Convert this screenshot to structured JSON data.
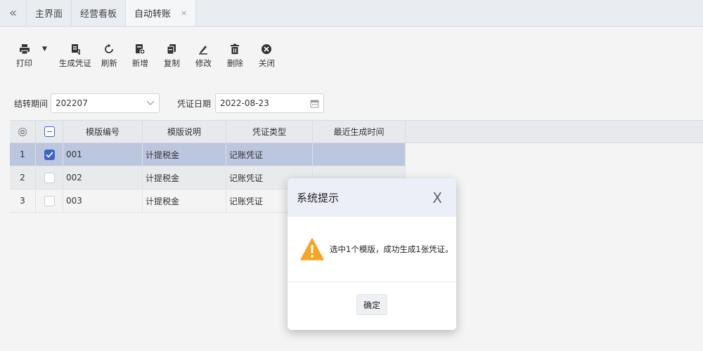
{
  "tabs": [
    {
      "label": "主界面"
    },
    {
      "label": "经营看板"
    },
    {
      "label": "自动转账",
      "active": true
    }
  ],
  "tab_collapse_icon": "double-chevron-left-icon",
  "tab_close_icon": "×",
  "toolbar": {
    "items": [
      {
        "label": "打印",
        "icon": "printer-icon"
      },
      {
        "label": "生成凭证",
        "icon": "generate-voucher-icon"
      },
      {
        "label": "刷新",
        "icon": "refresh-icon"
      },
      {
        "label": "新增",
        "icon": "add-doc-icon"
      },
      {
        "label": "复制",
        "icon": "copy-icon"
      },
      {
        "label": "修改",
        "icon": "edit-icon"
      },
      {
        "label": "删除",
        "icon": "trash-icon"
      },
      {
        "label": "关闭",
        "icon": "close-circle-icon"
      }
    ]
  },
  "filters": {
    "period_label": "结转期间",
    "period_value": "202207",
    "date_label": "凭证日期",
    "date_value": "2022-08-23"
  },
  "grid": {
    "columns": [
      "模版编号",
      "模版说明",
      "凭证类型",
      "最近生成时间"
    ],
    "rows": [
      {
        "index": "1",
        "checked": true,
        "code": "001",
        "desc": "计提税金",
        "type": "记账凭证",
        "time": ""
      },
      {
        "index": "2",
        "checked": false,
        "code": "002",
        "desc": "计提税金",
        "type": "记账凭证",
        "time": ""
      },
      {
        "index": "3",
        "checked": false,
        "code": "003",
        "desc": "计提税金",
        "type": "记账凭证",
        "time": ""
      }
    ]
  },
  "dialog": {
    "title": "系统提示",
    "close_symbol": "X",
    "message": "选中1个模版，成功生成1张凭证。",
    "ok_label": "确定"
  },
  "colors": {
    "accent": "#3c63c9",
    "selected_row": "#bcc6de",
    "warning": "#f5a623"
  }
}
